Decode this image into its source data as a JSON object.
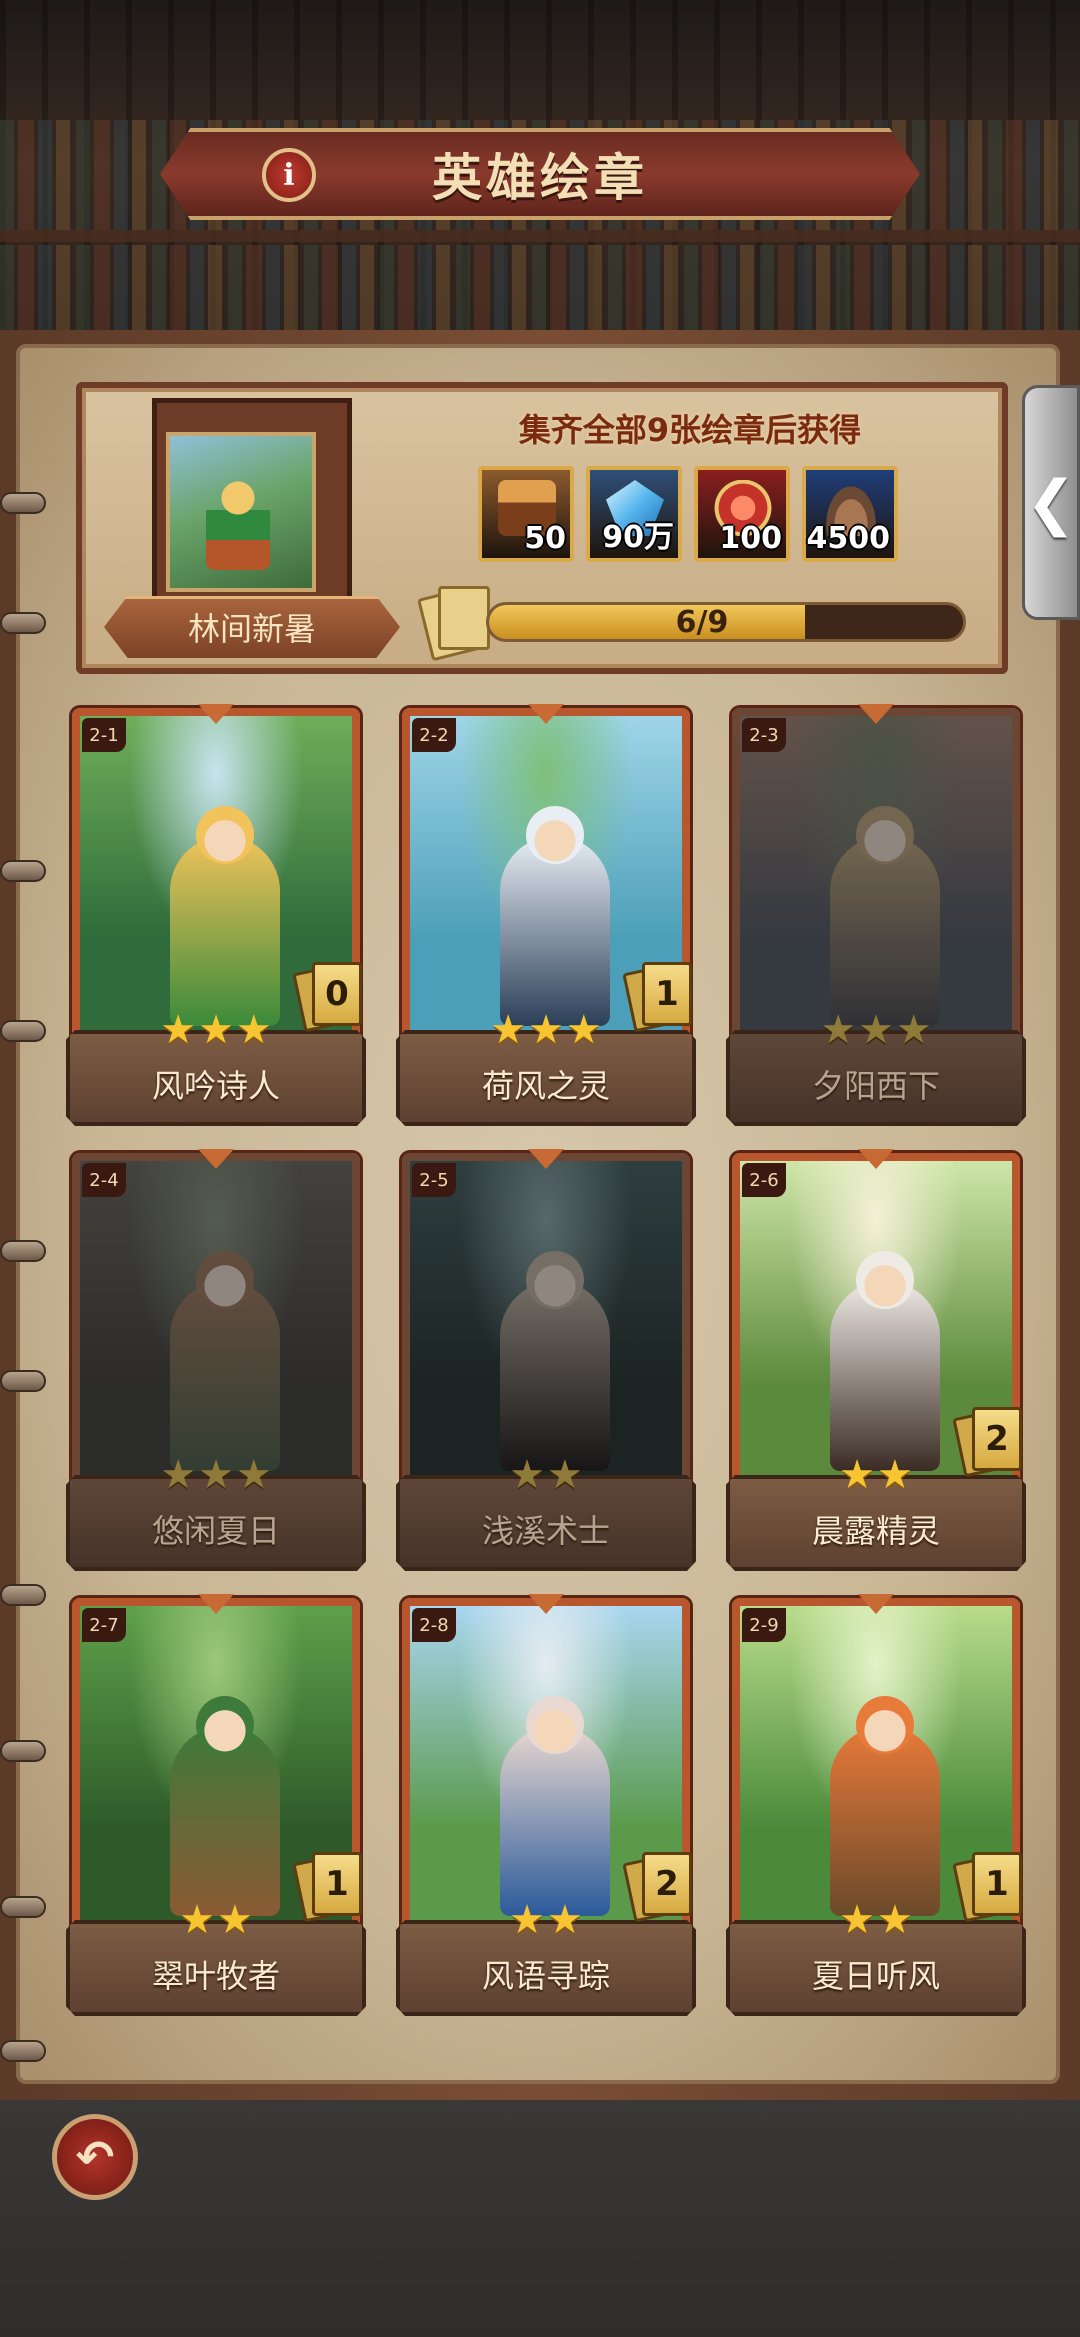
{
  "header": {
    "title": "英雄绘章",
    "info_icon": "info-icon",
    "info_glyph": "i"
  },
  "album": {
    "name": "林间新暑",
    "collect_hint": "集齐全部9张绘章后获得",
    "rewards": [
      {
        "icon": "chest-icon",
        "qty": "50",
        "bg": "#8c5a2e"
      },
      {
        "icon": "crystal-icon",
        "qty": "90万",
        "bg": "#2f4f78"
      },
      {
        "icon": "ruby-amulet-icon",
        "qty": "100",
        "bg": "#8a1f1f"
      },
      {
        "icon": "ore-pile-icon",
        "qty": "4500",
        "bg": "#1f3e7a"
      }
    ],
    "progress": {
      "label": "6/9",
      "collected": 6,
      "total": 9
    }
  },
  "side_tab": {
    "glyph": "❮"
  },
  "cards": [
    {
      "id": "2-1",
      "name": "风吟诗人",
      "stars": 3,
      "count": "0",
      "locked": false,
      "art": [
        "#6fae5a",
        "#2f6b3b",
        "#c8e4f0",
        "#f1c35a",
        "#3b8a3a"
      ]
    },
    {
      "id": "2-2",
      "name": "荷风之灵",
      "stars": 3,
      "count": "1",
      "locked": false,
      "art": [
        "#9fd5e8",
        "#4c9fb8",
        "#7ec07a",
        "#e8eef4",
        "#2b3f58"
      ]
    },
    {
      "id": "2-3",
      "name": "夕阳西下",
      "stars": 3,
      "count": "",
      "locked": true,
      "art": [
        "#c27d5c",
        "#4c5d7a",
        "#6a8a5a",
        "#d9a04a",
        "#4b4f60"
      ]
    },
    {
      "id": "2-4",
      "name": "悠闲夏日",
      "stars": 3,
      "count": "",
      "locked": true,
      "art": [
        "#6f6a5e",
        "#4a463e",
        "#7a9a6a",
        "#c8733a",
        "#3f6b3c"
      ]
    },
    {
      "id": "2-5",
      "name": "浅溪术士",
      "stars": 2,
      "count": "",
      "locked": true,
      "art": [
        "#2e6b6e",
        "#1c3f3c",
        "#6fb0b8",
        "#c9b08e",
        "#2a2024"
      ]
    },
    {
      "id": "2-6",
      "name": "晨露精灵",
      "stars": 2,
      "count": "2",
      "locked": false,
      "art": [
        "#cfe6a8",
        "#5c8a3c",
        "#f4f0d6",
        "#eeeae4",
        "#3a2c24"
      ]
    },
    {
      "id": "2-7",
      "name": "翠叶牧者",
      "stars": 2,
      "count": "1",
      "locked": false,
      "art": [
        "#5ea04a",
        "#2e5a2a",
        "#9cc87a",
        "#3e7a3a",
        "#8a5a34"
      ]
    },
    {
      "id": "2-8",
      "name": "风语寻踪",
      "stars": 2,
      "count": "2",
      "locked": false,
      "art": [
        "#a8d6f0",
        "#5a9a4a",
        "#e4ecf2",
        "#e8d8d0",
        "#2b5a9a"
      ]
    },
    {
      "id": "2-9",
      "name": "夏日听风",
      "stars": 2,
      "count": "1",
      "locked": false,
      "art": [
        "#b8dc8a",
        "#4a8a3a",
        "#e4f2c8",
        "#e87a3a",
        "#6a4a2a"
      ]
    }
  ],
  "footer": {
    "back_icon": "back-arrow-icon",
    "back_glyph": "↶"
  }
}
